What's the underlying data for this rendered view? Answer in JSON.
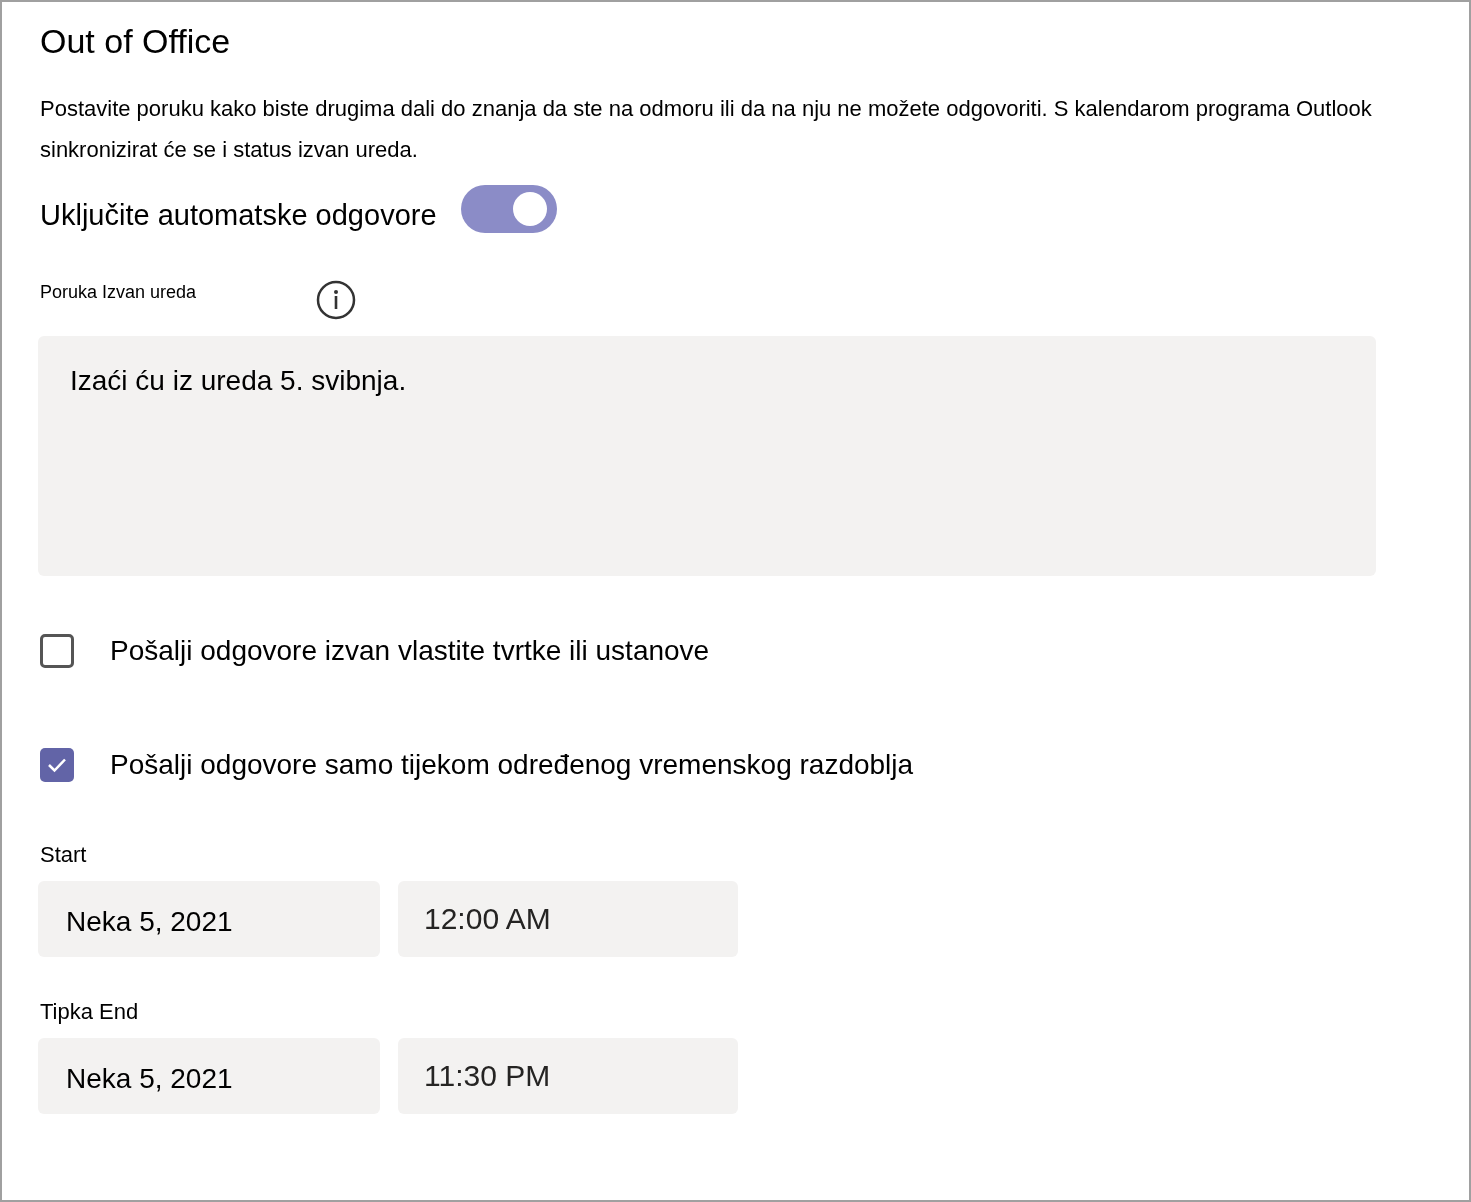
{
  "title": "Out of Office",
  "description": "Postavite poruku kako biste drugima dali do znanja da ste na odmoru ili da na nju ne možete odgovoriti. S kalendarom programa Outlook sinkronizirat će se i status izvan ureda.",
  "auto_reply": {
    "label": "Uključite automatske odgovore",
    "on": true
  },
  "message": {
    "label": "Poruka Izvan ureda",
    "value": "Izaći ću iz ureda 5. svibnja."
  },
  "options": [
    {
      "label": "Pošalji odgovore izvan vlastite tvrtke ili ustanove",
      "checked": false
    },
    {
      "label": "Pošalji odgovore samo tijekom određenog vremenskog razdoblja",
      "checked": true
    }
  ],
  "periods": [
    {
      "label": "Start",
      "date": "Neka 5, 2021",
      "time": "12:00 AM"
    },
    {
      "label": "Tipka End",
      "date": "Neka 5, 2021",
      "time": "11:30 PM"
    }
  ]
}
